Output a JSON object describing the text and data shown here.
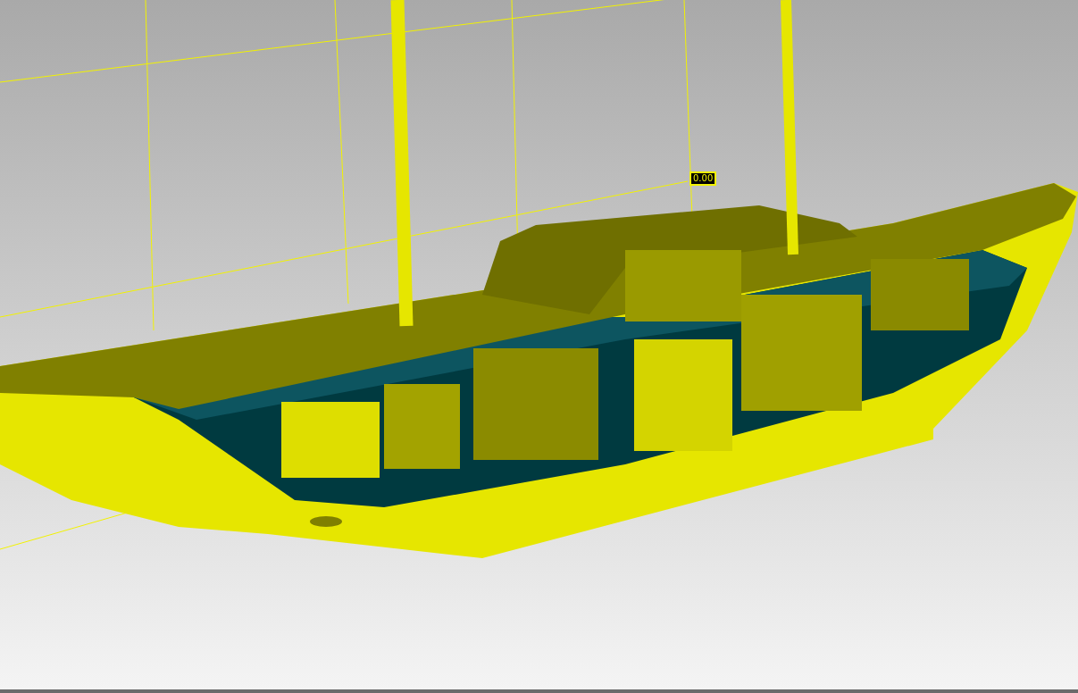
{
  "viewport": {
    "dimension_label": "0.00"
  }
}
